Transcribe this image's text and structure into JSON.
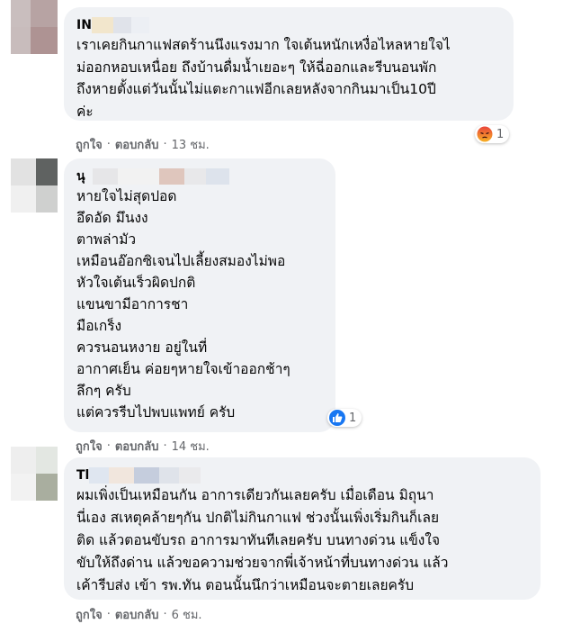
{
  "comments": [
    {
      "name_prefix": "IN",
      "lines": [
        "เราเคยกินกาแฟสดร้านนึงแรงมาก ใจเต้นหนักเหงื่อไหลหายใจไ",
        "ม่ออกหอบเหนื่อย ถึงบ้านดื่มน้ำเยอะๆ ให้ฉี่ออกและรีบนอนพัก",
        "ถึงหายตั้งแต่วันนั้นไม่แตะกาแฟอีกเลยหลังจากกินมาเป็น10ปี",
        "ค่ะ"
      ],
      "reaction_icon": "angry-reaction-icon",
      "reaction_count": "1",
      "like_label": "ถูกใจ",
      "reply_label": "ตอบกลับ",
      "time": "13 ชม."
    },
    {
      "name_prefix": "นุ",
      "lines": [
        "หายใจไม่สุดปอด",
        "อึดอัด มึนงง",
        "ตาพล่ามัว",
        "เหมือนอ๊อกซิเจนไปเลี้ยงสมองไม่พอ",
        "หัวใจเต้นเร็วผิดปกติ",
        "แขนขามีอาการชา",
        "มือเกร็ง",
        "ควรนอนหงาย อยู่ในที่",
        "อากาศเย็น ค่อยๆหายใจเข้าออกช้าๆ",
        "ลึกๆ ครับ",
        "แต่ควรรีบไปพบแพทย์ ครับ"
      ],
      "reaction_icon": "like-reaction-icon",
      "reaction_count": "1",
      "like_label": "ถูกใจ",
      "reply_label": "ตอบกลับ",
      "time": "14 ชม."
    },
    {
      "name_prefix": "Tl",
      "lines": [
        "ผมเพิ่งเป็นเหมือนกัน อาการเดียวกันเลยครับ เมื่อเดือน มิถุนา",
        "นี่เอง สเหตุคล้ายๆกัน ปกติไม่กินกาแฟ ช่วงนั้นเพิ่งเริ่มกินก็เลย",
        "ติด แล้วตอนขับรถ อาการมาทันทีเลยครับ บนทางด่วน แข็งใจ",
        "ขับให้ถึงด่าน แล้วขอความช่วยจากพี่เจ้าหน้าที่บนทางด่วน แล้ว",
        "เค้ารีบส่ง เข้า รพ.ทัน ตอนนั้นนึกว่าเหมือนจะตายเลยครับ"
      ],
      "like_label": "ถูกใจ",
      "reply_label": "ตอบกลับ",
      "time": "6 ชม."
    }
  ],
  "colors": {
    "bubble": "#f0f2f5",
    "meta": "#65676b",
    "like_blue": "#1877f2",
    "angry_orange": "#f4683c"
  }
}
